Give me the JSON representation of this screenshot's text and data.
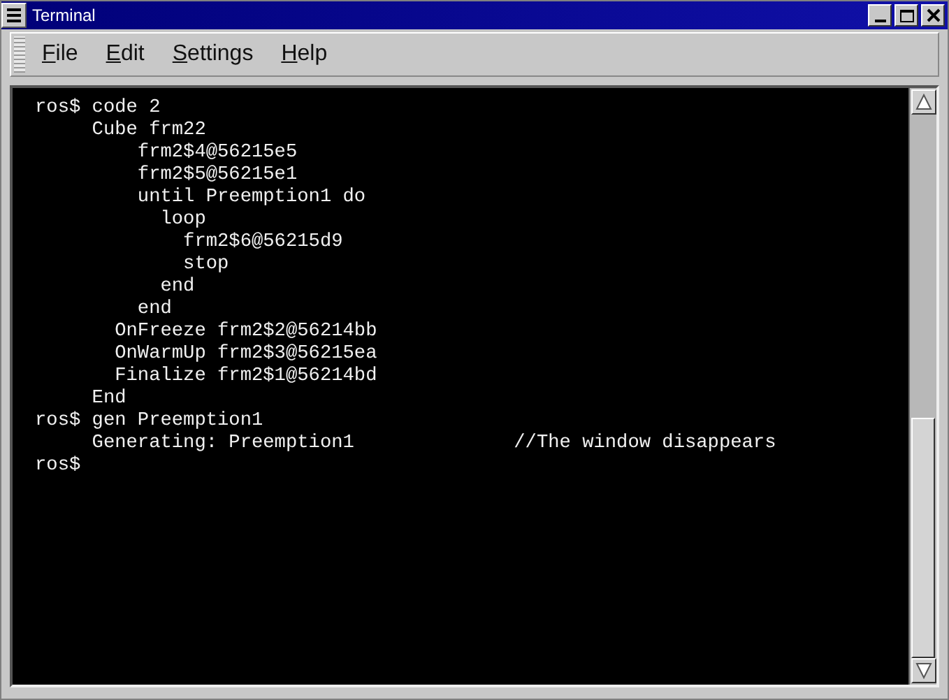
{
  "window": {
    "title": "Terminal"
  },
  "menu": [
    {
      "label": "File",
      "first_letter_underlined": true
    },
    {
      "label": "Edit",
      "first_letter_underlined": true
    },
    {
      "label": "Settings",
      "first_letter_underlined": true
    },
    {
      "label": "Help",
      "first_letter_underlined": true
    }
  ],
  "terminal": {
    "lines": [
      {
        "text": "ros$ code 2"
      },
      {
        "text": "     Cube frm22"
      },
      {
        "text": "         frm2$4@56215e5"
      },
      {
        "text": "         frm2$5@56215e1"
      },
      {
        "text": "         until Preemption1 do"
      },
      {
        "text": "           loop"
      },
      {
        "text": "             frm2$6@56215d9"
      },
      {
        "text": "             stop"
      },
      {
        "text": "           end"
      },
      {
        "text": "         end"
      },
      {
        "text": "       OnFreeze frm2$2@56214bb"
      },
      {
        "text": "       OnWarmUp frm2$3@56215ea"
      },
      {
        "text": "       Finalize frm2$1@56214bd"
      },
      {
        "text": "     End"
      },
      {
        "text": "ros$ gen Preemption1"
      },
      {
        "text": "     Generating: Preemption1",
        "comment": "//The window disappears"
      },
      {
        "text": "ros$"
      }
    ]
  }
}
